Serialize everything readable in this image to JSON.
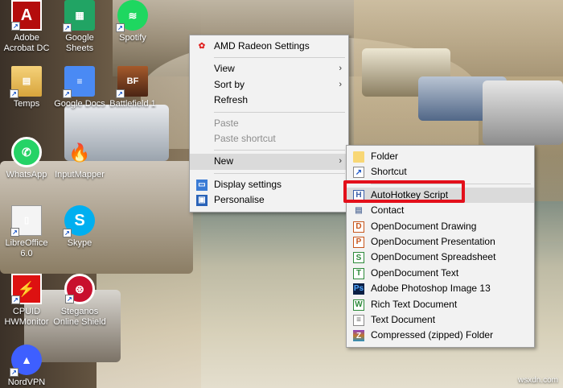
{
  "desktop": {
    "icons": [
      {
        "label": "Adobe\nAcrobat DC",
        "icon": "acrobat-icon",
        "glyph": "A"
      },
      {
        "label": "Google\nSheets",
        "icon": "google-sheets-icon",
        "glyph": "▦"
      },
      {
        "label": "Spotify",
        "icon": "spotify-icon",
        "glyph": "≋"
      },
      {
        "label": "Temps",
        "icon": "folder-icon",
        "glyph": "▤"
      },
      {
        "label": "Google Docs",
        "icon": "google-docs-icon",
        "glyph": "≡"
      },
      {
        "label": "Battlefield 1",
        "icon": "battlefield-icon",
        "glyph": "BF"
      },
      {
        "label": "WhatsApp",
        "icon": "whatsapp-icon",
        "glyph": "✆"
      },
      {
        "label": "InputMapper",
        "icon": "inputmapper-icon",
        "glyph": "🔥"
      },
      {
        "label": "LibreOffice\n6.0",
        "icon": "libreoffice-icon",
        "glyph": "▯"
      },
      {
        "label": "Skype",
        "icon": "skype-icon",
        "glyph": "S"
      },
      {
        "label": "CPUID\nHWMonitor",
        "icon": "hwmonitor-icon",
        "glyph": "⚡"
      },
      {
        "label": "Steganos\nOnline Shield",
        "icon": "steganos-icon",
        "glyph": "⊛"
      },
      {
        "label": "NordVPN",
        "icon": "nordvpn-icon",
        "glyph": "▲"
      }
    ],
    "shortcut_glyph": "↗"
  },
  "context_menu": {
    "amd": "AMD Radeon Settings",
    "view": "View",
    "sort_by": "Sort by",
    "refresh": "Refresh",
    "paste": "Paste",
    "paste_shortcut": "Paste shortcut",
    "new": "New",
    "display_settings": "Display settings",
    "personalise": "Personalise",
    "arrow": "›"
  },
  "new_submenu": {
    "folder": "Folder",
    "shortcut": "Shortcut",
    "autohotkey": "AutoHotkey Script",
    "contact": "Contact",
    "od_drawing": "OpenDocument Drawing",
    "od_presentation": "OpenDocument Presentation",
    "od_spreadsheet": "OpenDocument Spreadsheet",
    "od_text": "OpenDocument Text",
    "photoshop": "Adobe Photoshop Image 13",
    "rtf": "Rich Text Document",
    "txt": "Text Document",
    "zip": "Compressed (zipped) Folder"
  },
  "watermark": "wsxdn.com",
  "colors": {
    "highlight_border": "#e3101b",
    "menu_bg": "#f2f2f2",
    "menu_hover": "#dadada"
  }
}
